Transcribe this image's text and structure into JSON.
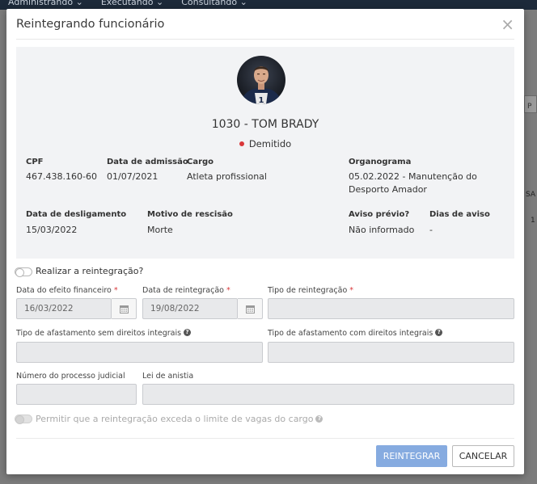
{
  "topnav": {
    "items": [
      "Administrando ⌄",
      "Executando ⌄",
      "Consultando ⌄"
    ]
  },
  "background": {
    "right_a": "P",
    "right_b": "SA",
    "right_c": "1"
  },
  "modal": {
    "title": "Reintegrando funcionário",
    "close_symbol": "×"
  },
  "employee": {
    "name": "1030 - TOM BRADY",
    "status": "Demitido",
    "status_color": "#d9373a",
    "fields": {
      "cpf": {
        "label": "CPF",
        "value": "467.438.160-60"
      },
      "admission": {
        "label": "Data de admissão",
        "value": "01/07/2021"
      },
      "cargo": {
        "label": "Cargo",
        "value": "Atleta profissional"
      },
      "organograma": {
        "label": "Organograma",
        "value": "05.02.2022 - Manutenção do Desporto Amador"
      },
      "desligamento": {
        "label": "Data de desligamento",
        "value": "15/03/2022"
      },
      "motivo": {
        "label": "Motivo de rescisão",
        "value": "Morte"
      },
      "aviso": {
        "label": "Aviso prévio?",
        "value": "Não informado"
      },
      "dias_aviso": {
        "label": "Dias de aviso",
        "value": "-"
      }
    }
  },
  "form": {
    "toggle_reintegrate": {
      "label": "Realizar a reintegração?",
      "on": false
    },
    "efeito_financeiro": {
      "label": "Data do efeito financeiro",
      "value": "16/03/2022",
      "required": true
    },
    "data_reintegracao": {
      "label": "Data de reintegração",
      "value": "19/08/2022",
      "required": true
    },
    "tipo_reintegracao": {
      "label": "Tipo de reintegração",
      "value": "",
      "required": true
    },
    "afastamento_sem": {
      "label": "Tipo de afastamento sem direitos integrais",
      "value": ""
    },
    "afastamento_com": {
      "label": "Tipo de afastamento com direitos integrais",
      "value": ""
    },
    "processo_judicial": {
      "label": "Número do processo judicial",
      "value": ""
    },
    "lei_anistia": {
      "label": "Lei de anistia",
      "value": ""
    },
    "toggle_exceed": {
      "label": "Permitir que a reintegração exceda o limite de vagas do cargo",
      "on": false,
      "disabled": true
    },
    "required_mark": "*",
    "help_mark": "?"
  },
  "buttons": {
    "reintegrar": "REINTEGRAR",
    "cancelar": "CANCELAR"
  }
}
